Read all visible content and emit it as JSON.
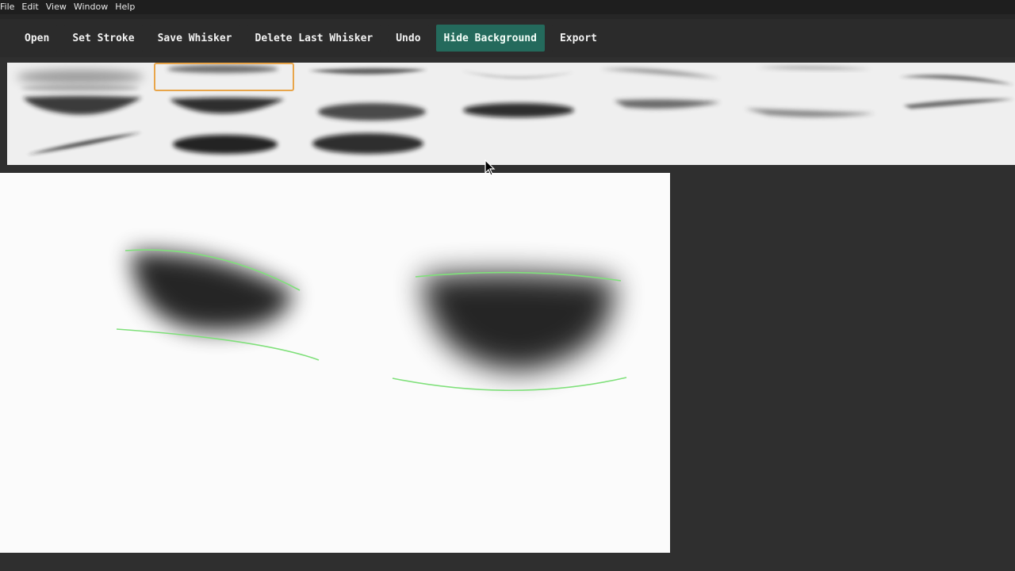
{
  "menu": {
    "items": [
      "File",
      "Edit",
      "View",
      "Window",
      "Help"
    ]
  },
  "toolbar": {
    "open": "Open",
    "set_stroke": "Set Stroke",
    "save_whisker": "Save Whisker",
    "delete_last_whisker": "Delete Last Whisker",
    "undo": "Undo",
    "hide_background": "Hide Background",
    "export": "Export",
    "active_color": "#246a5c"
  },
  "gallery": {
    "selected_index": 1,
    "selection_color": "#e8a54a",
    "thumbnail_count": 17
  },
  "canvas": {
    "guide_color": "#7fe07a",
    "whisker_count": 2
  },
  "cursor": {
    "icon": "arrow-cursor-icon"
  }
}
